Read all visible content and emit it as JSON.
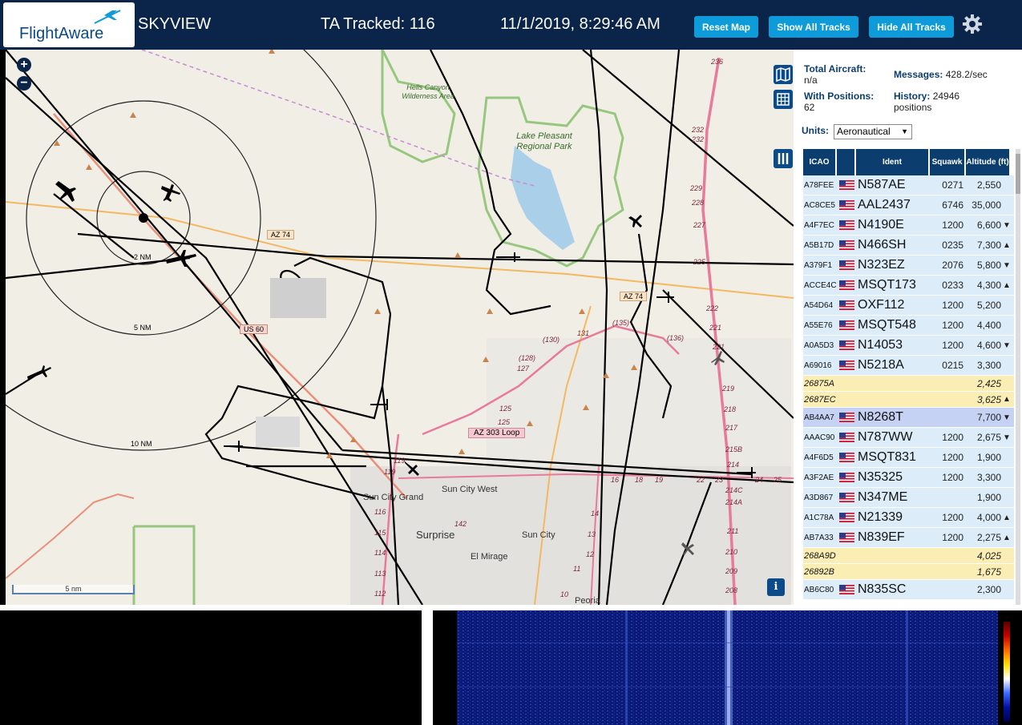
{
  "header": {
    "logo_text": "FlightAware",
    "app_title": "SKYVIEW",
    "tracked": "TA Tracked: 116",
    "datetime": "11/1/2019, 8:29:46 AM",
    "buttons": {
      "reset_map": "Reset Map",
      "show_all": "Show All Tracks",
      "hide_all": "Hide All Tracks"
    },
    "accent_color": "#0d9bd9",
    "bar_color": "#0b2449"
  },
  "map": {
    "zoom_in": "+",
    "zoom_out": "−",
    "scale_label": "5 nm",
    "info": "i",
    "range_labels": {
      "r2": "2 NM",
      "r5": "5 NM",
      "r10": "10 NM"
    },
    "places": {
      "wilderness": "Hells Canyon Wilderness Area",
      "park": "Lake Pleasant Regional Park",
      "sun_city_west": "Sun City West",
      "sun_city_grand": "Sun City Grand",
      "surprise": "Surprise",
      "sun_city": "Sun City",
      "el_mirage": "El Mirage",
      "peoria": "Peoria"
    },
    "road_shields": {
      "az74": "AZ 74",
      "az74b": "AZ 74",
      "us60": "US 60",
      "loop303": "AZ 303 Loop"
    },
    "road_numbers": [
      "236",
      "232",
      "232",
      "229",
      "228",
      "227",
      "225",
      "222",
      "221",
      "221",
      "219",
      "218",
      "217",
      "215B",
      "214",
      "214C",
      "214A",
      "211",
      "210",
      "209",
      "208",
      "116",
      "115",
      "114",
      "113",
      "112",
      "142",
      "14",
      "13",
      "12",
      "11",
      "10",
      "16",
      "18",
      "19",
      "22",
      "23",
      "24",
      "25",
      "(128)",
      "127",
      "125",
      "125",
      "(130)",
      "131",
      "(135)",
      "(136)",
      "119",
      "119"
    ]
  },
  "stats": {
    "total_label": "Total Aircraft:",
    "total_value": "n/a",
    "positions_label": "With Positions:",
    "positions_value": "62",
    "messages_label": "Messages:",
    "messages_value": "428.2/sec",
    "history_label": "History:",
    "history_value": "24946 positions",
    "units_label": "Units:",
    "units_value": "Aeronautical"
  },
  "table": {
    "columns": [
      "ICAO",
      "",
      "Ident",
      "Squawk",
      "Altitude (ft)"
    ],
    "rows": [
      {
        "icao": "A78FEE",
        "flag": true,
        "ident": "N587AE",
        "squawk": "0271",
        "alt": "2,550",
        "trend": "",
        "style": ""
      },
      {
        "icao": "AC8CE5",
        "flag": true,
        "ident": "AAL2437",
        "squawk": "6746",
        "alt": "35,000",
        "trend": "",
        "style": ""
      },
      {
        "icao": "A4F7EC",
        "flag": true,
        "ident": "N4190E",
        "squawk": "1200",
        "alt": "6,600",
        "trend": "▼",
        "style": ""
      },
      {
        "icao": "A5B17D",
        "flag": true,
        "ident": "N466SH",
        "squawk": "0235",
        "alt": "7,300",
        "trend": "▲",
        "style": ""
      },
      {
        "icao": "A379F1",
        "flag": true,
        "ident": "N323EZ",
        "squawk": "2076",
        "alt": "5,800",
        "trend": "▼",
        "style": ""
      },
      {
        "icao": "ACCE4C",
        "flag": true,
        "ident": "MSQT173",
        "squawk": "0233",
        "alt": "4,300",
        "trend": "▲",
        "style": ""
      },
      {
        "icao": "A54D64",
        "flag": true,
        "ident": "OXF112",
        "squawk": "1200",
        "alt": "5,200",
        "trend": "",
        "style": ""
      },
      {
        "icao": "A55E76",
        "flag": true,
        "ident": "MSQT548",
        "squawk": "1200",
        "alt": "4,400",
        "trend": "",
        "style": ""
      },
      {
        "icao": "A0A5D3",
        "flag": true,
        "ident": "N14053",
        "squawk": "1200",
        "alt": "4,600",
        "trend": "▼",
        "style": ""
      },
      {
        "icao": "A69016",
        "flag": true,
        "ident": "N5218A",
        "squawk": "0215",
        "alt": "3,300",
        "trend": "",
        "style": ""
      },
      {
        "icao": "26875A",
        "flag": false,
        "ident": "",
        "squawk": "",
        "alt": "2,425",
        "trend": "",
        "style": "yellow"
      },
      {
        "icao": "2687EC",
        "flag": false,
        "ident": "",
        "squawk": "",
        "alt": "3,625",
        "trend": "▲",
        "style": "yellow"
      },
      {
        "icao": "AB4AA7",
        "flag": true,
        "ident": "N8268T",
        "squawk": "",
        "alt": "7,700",
        "trend": "▼",
        "style": "sel"
      },
      {
        "icao": "AAAC90",
        "flag": true,
        "ident": "N787WW",
        "squawk": "1200",
        "alt": "2,675",
        "trend": "▼",
        "style": ""
      },
      {
        "icao": "A4F6D5",
        "flag": true,
        "ident": "MSQT831",
        "squawk": "1200",
        "alt": "1,900",
        "trend": "",
        "style": ""
      },
      {
        "icao": "A3F2AE",
        "flag": true,
        "ident": "N35325",
        "squawk": "1200",
        "alt": "3,300",
        "trend": "",
        "style": ""
      },
      {
        "icao": "A3D867",
        "flag": true,
        "ident": "N347ME",
        "squawk": "",
        "alt": "1,900",
        "trend": "",
        "style": ""
      },
      {
        "icao": "A1C78A",
        "flag": true,
        "ident": "N21339",
        "squawk": "1200",
        "alt": "4,000",
        "trend": "▲",
        "style": ""
      },
      {
        "icao": "AB7A33",
        "flag": true,
        "ident": "N839EF",
        "squawk": "1200",
        "alt": "2,275",
        "trend": "▲",
        "style": ""
      },
      {
        "icao": "268A9D",
        "flag": false,
        "ident": "",
        "squawk": "",
        "alt": "4,025",
        "trend": "",
        "style": "yellow"
      },
      {
        "icao": "26892B",
        "flag": false,
        "ident": "",
        "squawk": "",
        "alt": "1,675",
        "trend": "",
        "style": "yellow"
      },
      {
        "icao": "AB6C80",
        "flag": true,
        "ident": "N835SC",
        "squawk": "",
        "alt": "2,300",
        "trend": "",
        "style": ""
      }
    ]
  }
}
